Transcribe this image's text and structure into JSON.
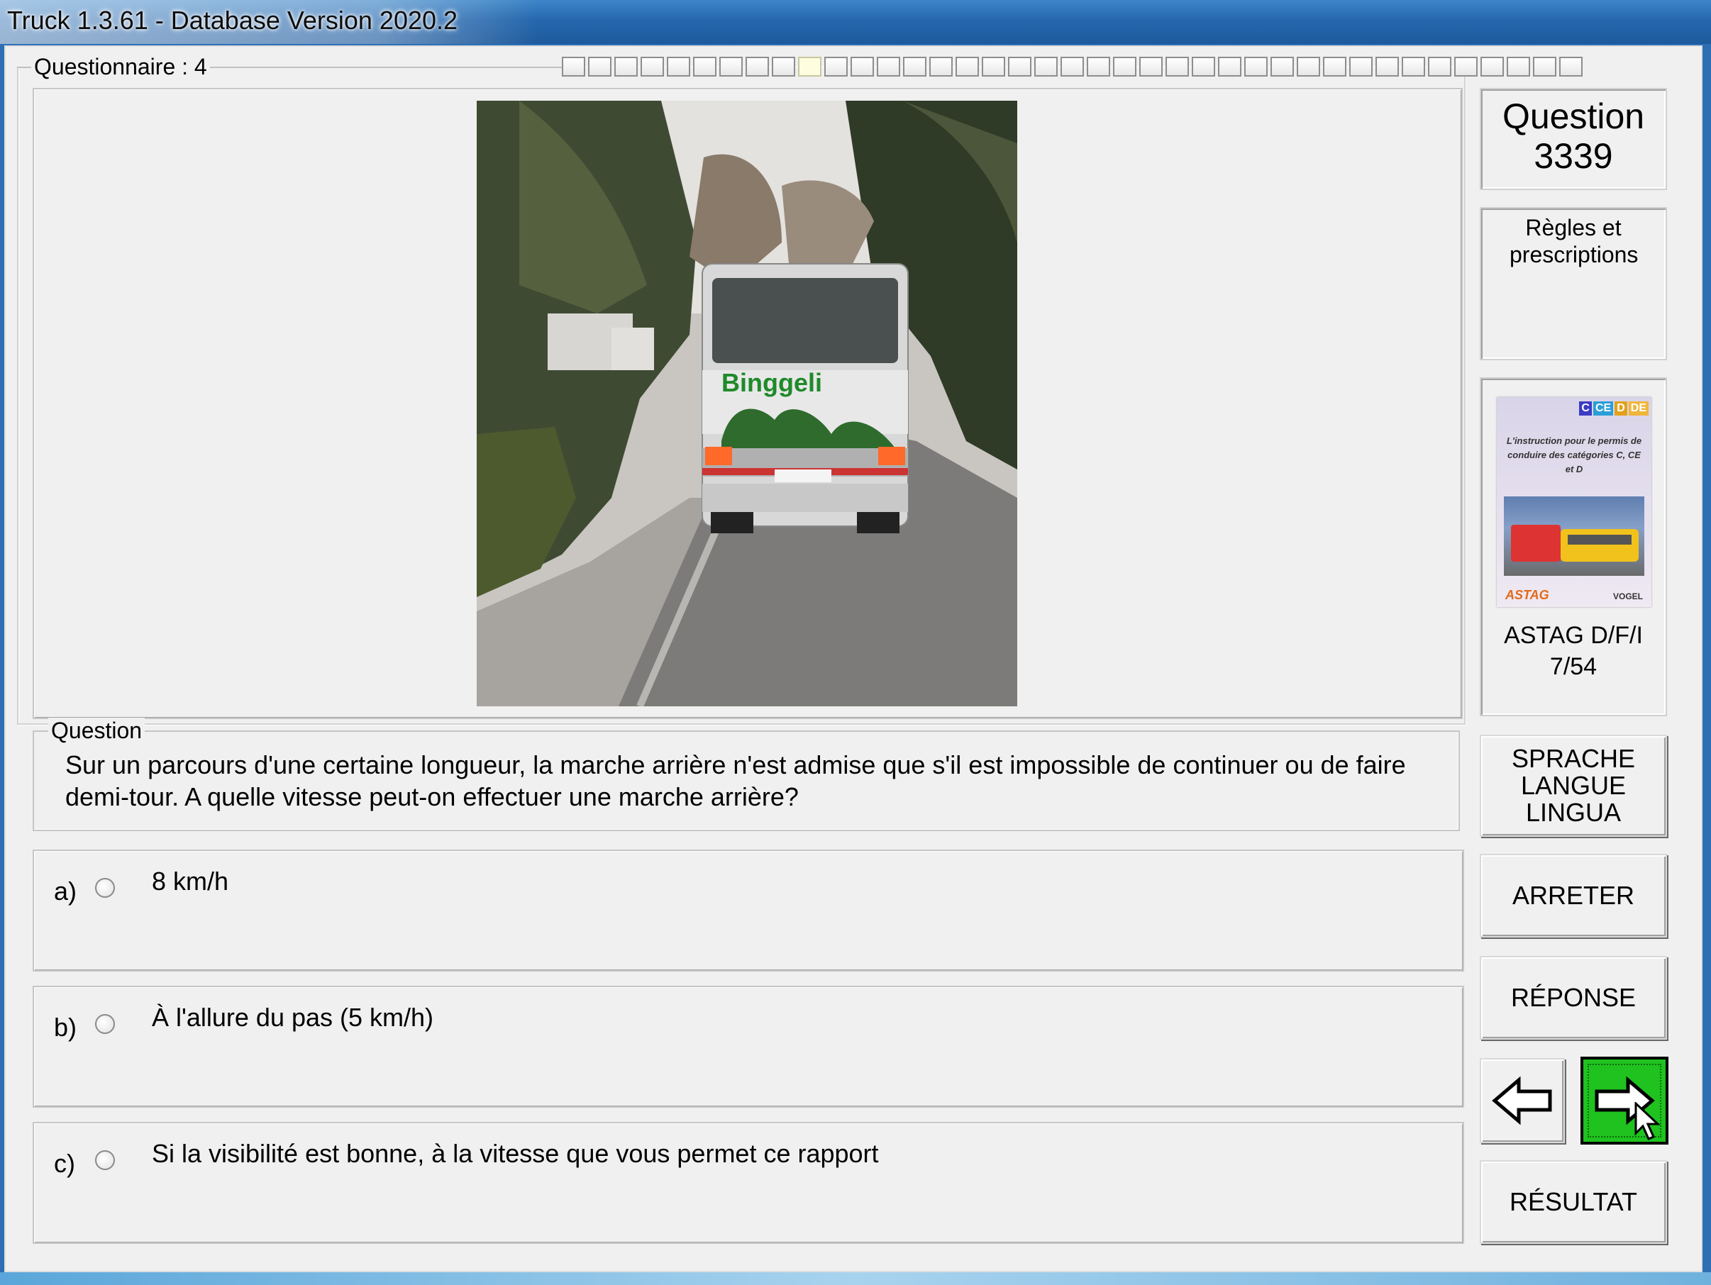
{
  "window": {
    "title": "Truck 1.3.61 - Database Version 2020.2"
  },
  "questionnaire": {
    "label": "Questionnaire : 4",
    "progress_total": 39,
    "progress_current": 10
  },
  "question_header": {
    "title": "Question",
    "number": "3339"
  },
  "category": {
    "label": "Règles et prescriptions"
  },
  "source": {
    "reference_line1": "ASTAG D/F/I",
    "reference_line2": "7/54",
    "book": {
      "badge": [
        "C",
        "CE",
        "D",
        "DE"
      ],
      "text": "L'instruction pour le permis de conduire des catégories C, CE et D",
      "logo_left": "ASTAG",
      "logo_right": "VOGEL"
    }
  },
  "photo": {
    "bus_name": "Binggeli"
  },
  "question": {
    "group_label": "Question",
    "text": "Sur un parcours d'une certaine longueur, la marche arrière n'est admise que s'il est impossible de continuer ou de faire demi-tour. A quelle vitesse peut-on effectuer une marche arrière?"
  },
  "answers": [
    {
      "letter": "a)",
      "text": "8 km/h"
    },
    {
      "letter": "b)",
      "text": "À l'allure du pas (5 km/h)"
    },
    {
      "letter": "c)",
      "text": "Si la visibilité est bonne, à la vitesse que vous permet ce rapport"
    }
  ],
  "buttons": {
    "language": [
      "SPRACHE",
      "LANGUE",
      "LINGUA"
    ],
    "stop": "ARRETER",
    "answer": "RÉPONSE",
    "result": "RÉSULTAT"
  },
  "colors": {
    "titlebar": "#2567ad",
    "next_button": "#1fc21f",
    "client_bg": "#f0f0f0"
  }
}
